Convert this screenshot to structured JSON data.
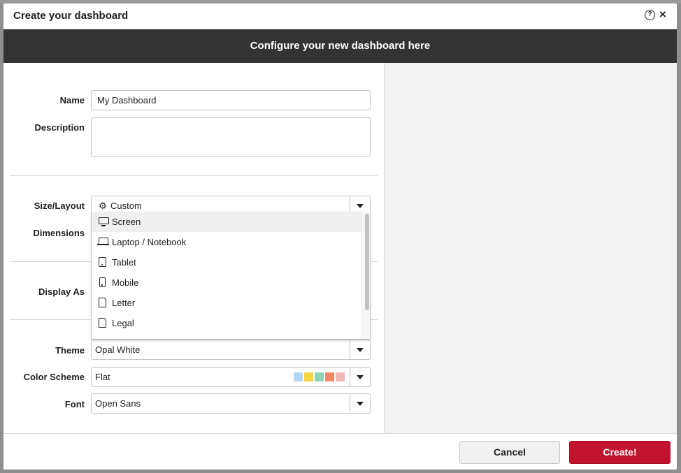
{
  "modal": {
    "title": "Create your dashboard",
    "help_icon": "question-circle-icon",
    "help_glyph": "?",
    "close_icon": "close-icon",
    "close_glyph": "×"
  },
  "banner": {
    "text": "Configure your new dashboard here"
  },
  "form": {
    "name_label": "Name",
    "name_value": "My Dashboard",
    "description_label": "Description",
    "description_value": "",
    "size_layout_label": "Size/Layout",
    "size_layout_value": "Custom",
    "size_layout_icon": "gear-icon",
    "dimensions_label": "Dimensions",
    "display_as_label": "Display As",
    "theme_label": "Theme",
    "theme_value": "Opal White",
    "color_scheme_label": "Color Scheme",
    "color_scheme_value": "Flat",
    "color_scheme_swatches": [
      "#b3d7f2",
      "#f4d442",
      "#8fd3b5",
      "#f08a66",
      "#f2b8b8"
    ],
    "font_label": "Font",
    "font_value": "Open Sans"
  },
  "size_dropdown": {
    "options": [
      {
        "label": "Screen",
        "icon": "monitor-icon",
        "highlighted": true
      },
      {
        "label": "Laptop / Notebook",
        "icon": "laptop-icon",
        "highlighted": false
      },
      {
        "label": "Tablet",
        "icon": "tablet-icon",
        "highlighted": false
      },
      {
        "label": "Mobile",
        "icon": "mobile-icon",
        "highlighted": false
      },
      {
        "label": "Letter",
        "icon": "document-icon",
        "highlighted": false
      },
      {
        "label": "Legal",
        "icon": "document-icon",
        "highlighted": false
      }
    ]
  },
  "footer": {
    "cancel_label": "Cancel",
    "create_label": "Create!"
  },
  "colors": {
    "banner_bg": "#333333",
    "accent_create": "#c1132e",
    "preview_bg": "#f2f2f2"
  }
}
